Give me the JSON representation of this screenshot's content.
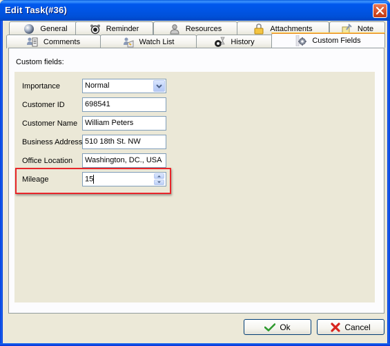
{
  "window": {
    "title": "Edit Task(#36)",
    "close_icon": "close-icon"
  },
  "tabs": {
    "row1": [
      {
        "label": "General",
        "icon": "sphere-icon"
      },
      {
        "label": "Reminder",
        "icon": "alarm-clock-icon"
      },
      {
        "label": "Resources",
        "icon": "person-icon"
      },
      {
        "label": "Attachments",
        "icon": "padlock-folder-icon"
      },
      {
        "label": "Note",
        "icon": "pushpin-note-icon"
      }
    ],
    "row2": [
      {
        "label": "Comments",
        "icon": "comments-icon"
      },
      {
        "label": "Watch List",
        "icon": "watch-list-icon"
      },
      {
        "label": "History",
        "icon": "history-icon"
      },
      {
        "label": "Custom Fields",
        "icon": "gear-icon",
        "active": true
      }
    ]
  },
  "panel": {
    "heading": "Custom fields:",
    "fields": [
      {
        "label": "Importance",
        "value": "Normal",
        "type": "dropdown"
      },
      {
        "label": "Customer ID",
        "value": "698541",
        "type": "text"
      },
      {
        "label": "Customer Name",
        "value": "William Peters",
        "type": "text"
      },
      {
        "label": "Business Address",
        "value": "510 18th St. NW",
        "type": "text"
      },
      {
        "label": "Office Location",
        "value": "Washington, DC., USA",
        "type": "text"
      },
      {
        "label": "Mileage",
        "value": "15",
        "type": "spinner",
        "highlighted": true
      }
    ]
  },
  "buttons": {
    "ok": "Ok",
    "cancel": "Cancel"
  },
  "colors": {
    "titlebar": "#0055E5",
    "highlight": "#E8262A",
    "active_tab_accent": "#E68B2C",
    "ok_check": "#2E9A2E",
    "cancel_x": "#D8241E"
  }
}
